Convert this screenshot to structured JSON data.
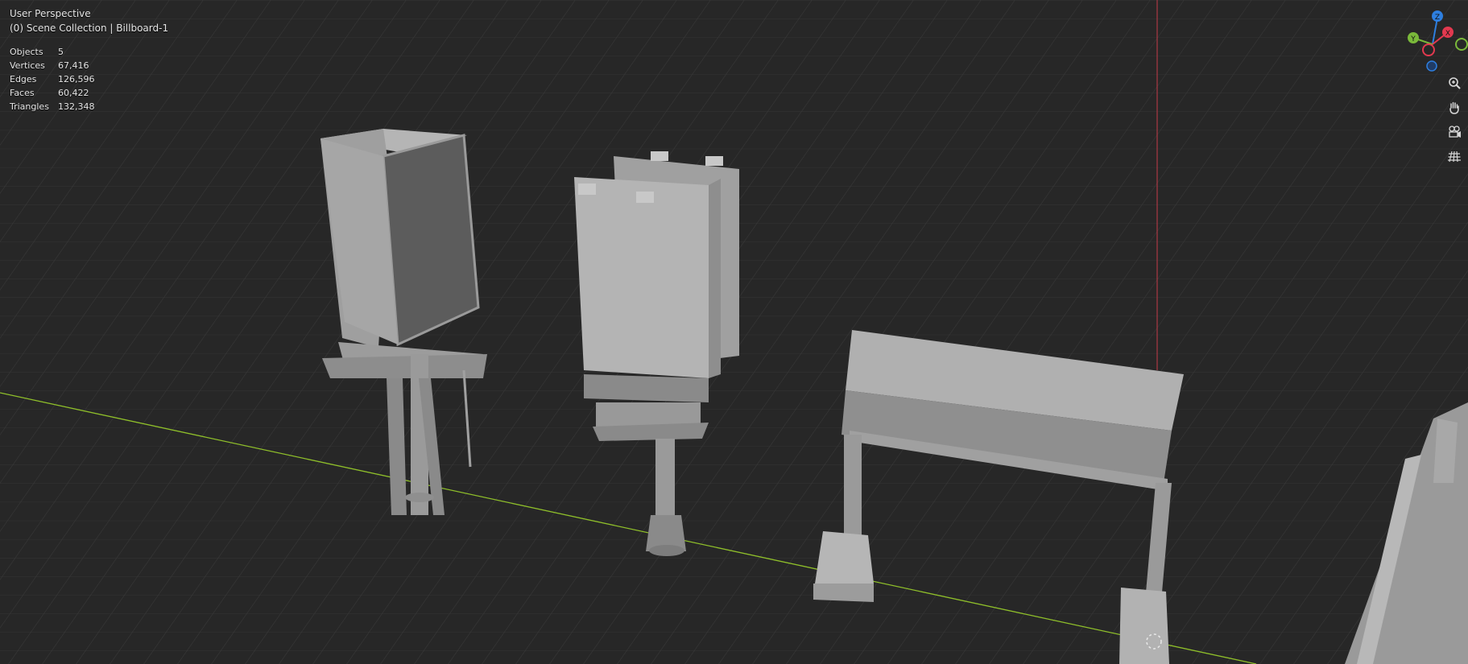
{
  "viewport": {
    "title": "User Perspective",
    "collection": "(0) Scene Collection | Billboard-1"
  },
  "stats": [
    {
      "label": "Objects",
      "value": "5"
    },
    {
      "label": "Vertices",
      "value": "67,416"
    },
    {
      "label": "Edges",
      "value": "126,596"
    },
    {
      "label": "Faces",
      "value": "60,422"
    },
    {
      "label": "Triangles",
      "value": "132,348"
    }
  ],
  "gizmo": {
    "z_label": "Z",
    "x_label": "X",
    "y_label": "Y",
    "colors": {
      "x": "#e2394f",
      "y": "#7ab93a",
      "z": "#2e7fe0"
    }
  },
  "nav_tools": [
    {
      "name": "zoom-icon"
    },
    {
      "name": "pan-hand-icon"
    },
    {
      "name": "camera-icon"
    },
    {
      "name": "orthographic-grid-icon"
    }
  ],
  "colors": {
    "background": "#262626",
    "grid": "#3a3a3a",
    "x_axis": "#8fbf2a",
    "y_axis": "#c43b4a",
    "object": "#a9a9a9"
  }
}
